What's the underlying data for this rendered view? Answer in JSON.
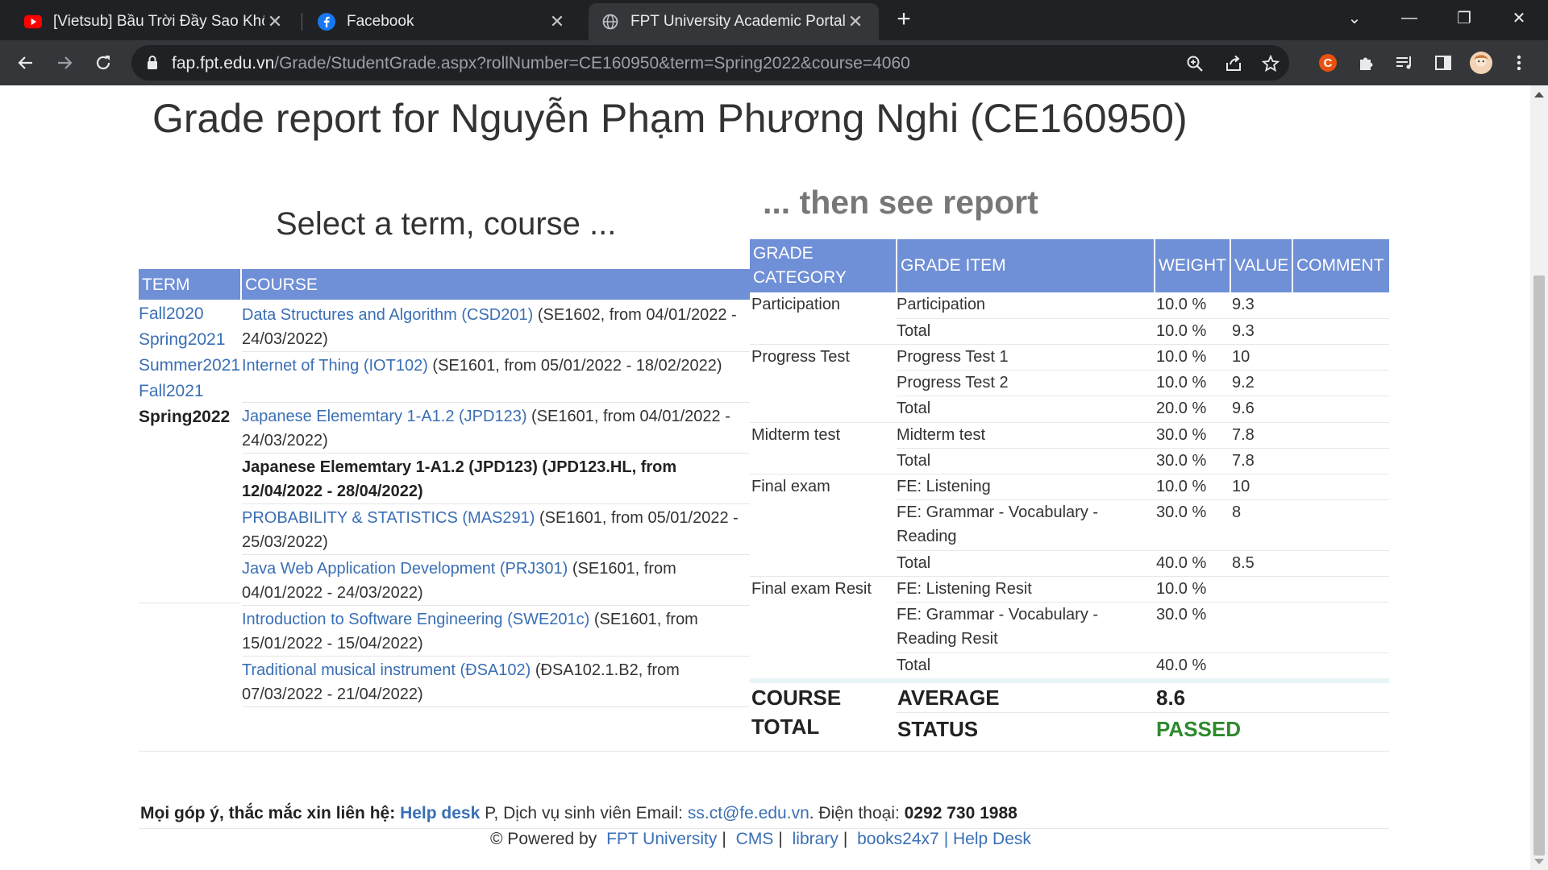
{
  "browser": {
    "tabs": [
      {
        "title": "[Vietsub] Bầu Trời Đầy Sao Không",
        "icon": "youtube-icon"
      },
      {
        "title": "Facebook",
        "icon": "facebook-icon"
      },
      {
        "title": "FPT University Academic Portal",
        "icon": "globe-icon"
      }
    ],
    "url_host": "fap.fpt.edu.vn",
    "url_path": "/Grade/StudentGrade.aspx?rollNumber=CE160950&term=Spring2022&course=4060"
  },
  "page": {
    "title": "Grade report for Nguyễn Phạm Phương Nghi (CE160950)",
    "select_heading": "Select a term, course ...",
    "then_heading": "... then see report"
  },
  "left_table": {
    "headers": {
      "term": "TERM",
      "course": "COURSE"
    },
    "terms": [
      "Fall2020",
      "Spring2021",
      "Summer2021",
      "Fall2021",
      "Spring2022"
    ],
    "selected_term": "Spring2022",
    "courses": [
      {
        "name": "Data Structures and Algorithm (CSD201)",
        "detail": " (SE1602, from 04/01/2022 - 24/03/2022)"
      },
      {
        "name": "Internet of Thing (IOT102)",
        "detail": " (SE1601, from 05/01/2022 - 18/02/2022)"
      },
      {
        "name": "Japanese Elememtary 1-A1.2 (JPD123)",
        "detail": " (SE1601, from 04/01/2022 - 24/03/2022)"
      },
      {
        "name": "Japanese Elememtary 1-A1.2 (JPD123)",
        "detail": " (JPD123.HL, from 12/04/2022 - 28/04/2022)"
      },
      {
        "name": "PROBABILITY & STATISTICS (MAS291)",
        "detail": " (SE1601, from 05/01/2022 - 25/03/2022)"
      },
      {
        "name": "Java Web Application Development (PRJ301)",
        "detail": " (SE1601, from 04/01/2022 - 24/03/2022)"
      },
      {
        "name": "Introduction to Software Engineering (SWE201c)",
        "detail": " (SE1601, from 15/01/2022 - 15/04/2022)"
      },
      {
        "name": "Traditional musical instrument (ĐSA102)",
        "detail": " (ĐSA102.1.B2, from 07/03/2022 - 21/04/2022)"
      }
    ]
  },
  "grade_table": {
    "headers": {
      "category": "GRADE CATEGORY",
      "item": "GRADE ITEM",
      "weight": "WEIGHT",
      "value": "VALUE",
      "comment": "COMMENT"
    },
    "categories": [
      "Participation",
      "Progress Test",
      "Midterm test",
      "Final exam",
      "Final exam Resit"
    ],
    "rows": [
      {
        "item": "Participation",
        "weight": "10.0 %",
        "value": "9.3"
      },
      {
        "item": "Total",
        "weight": "10.0 %",
        "value": "9.3"
      },
      {
        "item": "Progress Test 1",
        "weight": "10.0 %",
        "value": "10"
      },
      {
        "item": "Progress Test 2",
        "weight": "10.0 %",
        "value": "9.2"
      },
      {
        "item": "Total",
        "weight": "20.0 %",
        "value": "9.6"
      },
      {
        "item": "Midterm test",
        "weight": "30.0 %",
        "value": "7.8"
      },
      {
        "item": "Total",
        "weight": "30.0 %",
        "value": "7.8"
      },
      {
        "item": "FE: Listening",
        "weight": "10.0 %",
        "value": "10"
      },
      {
        "item": "FE: Grammar - Vocabulary - Reading",
        "weight": "30.0 %",
        "value": "8"
      },
      {
        "item": "Total",
        "weight": "40.0 %",
        "value": "8.5"
      },
      {
        "item": "FE: Listening Resit",
        "weight": "10.0 %",
        "value": ""
      },
      {
        "item": "FE: Grammar - Vocabulary - Reading Resit",
        "weight": "30.0 %",
        "value": ""
      },
      {
        "item": "Total",
        "weight": "40.0 %",
        "value": ""
      }
    ],
    "course_total": {
      "label_line1": "COURSE",
      "label_line2": "TOTAL",
      "average_label": "AVERAGE",
      "average": "8.6",
      "status_label": "STATUS",
      "status": "PASSED"
    }
  },
  "footer": {
    "contact_label": "Mọi góp ý, thắc mắc xin liên hệ:",
    "helpdesk": "Help desk",
    "contact_mid": " P, Dịch vụ sinh viên Email: ",
    "email": "ss.ct@fe.edu.vn",
    "phone_label": ". Điện thoại: ",
    "phone": "0292 730 1988",
    "powered": "© Powered by",
    "links": [
      "FPT University",
      "CMS",
      "library",
      "books24x7",
      "Help Desk"
    ]
  },
  "colors": {
    "header_bg": "#6f8fd6",
    "link": "#3a6fb5",
    "passed": "#2d8a2d"
  }
}
